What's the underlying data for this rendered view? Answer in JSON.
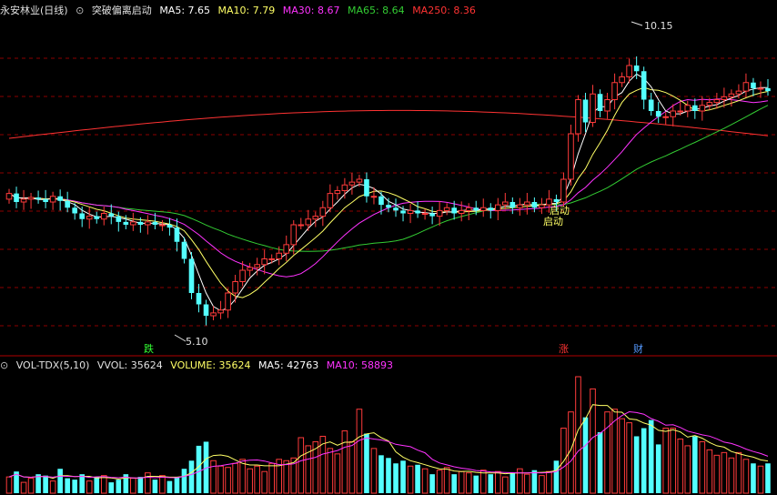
{
  "header": {
    "stock_title": "永安林业(日线)",
    "indicator_name": "突破偏离启动",
    "ma5": "MA5: 7.65",
    "ma10": "MA10: 7.79",
    "ma30": "MA30: 8.67",
    "ma65": "MA65: 8.64",
    "ma250": "MA250: 8.36"
  },
  "volume_header": {
    "indicator_name": "VOL-TDX(5,10)",
    "vvol": "VVOL: 35624",
    "volume": "VOLUME: 35624",
    "ma5": "MA5: 42763",
    "ma10": "MA10: 58893"
  },
  "colors": {
    "up": "#ff3b3b",
    "down": "#54ffff",
    "ma5": "#ffffff",
    "ma10": "#ffff66",
    "ma30": "#ff33ff",
    "ma65": "#33cc33",
    "ma250": "#ff3333",
    "grid": "#8b0000"
  },
  "annotations": {
    "high_label": "10.15",
    "low_label": "5.10",
    "signal_1": "启动",
    "signal_2": "启动",
    "marker_die": "跌",
    "marker_zhang": "涨",
    "marker_cai": "财"
  },
  "chart_data": [
    {
      "type": "candlestick",
      "title": "永安林业(日线)",
      "ylim": [
        4.9,
        10.5
      ],
      "high": 10.15,
      "low": 5.1,
      "series": {
        "open": [
          7.35,
          7.45,
          7.3,
          7.35,
          7.38,
          7.35,
          7.3,
          7.4,
          7.32,
          7.2,
          7.1,
          7.0,
          7.05,
          7.0,
          7.1,
          7.05,
          6.95,
          6.9,
          6.95,
          6.9,
          6.95,
          6.9,
          6.9,
          6.85,
          6.6,
          6.3,
          5.7,
          5.5,
          5.3,
          5.35,
          5.4,
          5.7,
          5.9,
          6.1,
          6.15,
          6.2,
          6.3,
          6.3,
          6.4,
          6.55,
          6.9,
          6.9,
          7.0,
          7.05,
          7.2,
          7.45,
          7.5,
          7.6,
          7.65,
          7.7,
          7.4,
          7.4,
          7.25,
          7.2,
          7.15,
          7.1,
          7.15,
          7.1,
          7.1,
          7.05,
          7.15,
          7.2,
          7.1,
          7.15,
          7.2,
          7.15,
          7.2,
          7.15,
          7.25,
          7.3,
          7.2,
          7.25,
          7.3,
          7.2,
          7.25,
          7.35,
          7.3,
          7.7,
          8.5,
          9.1,
          8.7,
          9.2,
          8.9,
          9.1,
          9.4,
          9.5,
          9.7,
          9.6,
          9.1,
          8.9,
          8.8,
          8.8,
          8.9,
          8.9,
          9.0,
          8.9,
          9.0,
          9.05,
          9.1,
          9.15,
          9.2,
          9.25,
          9.4,
          9.3,
          9.3
        ],
        "close": [
          7.45,
          7.3,
          7.35,
          7.38,
          7.35,
          7.3,
          7.4,
          7.32,
          7.2,
          7.1,
          7.0,
          7.05,
          7.0,
          7.1,
          7.05,
          6.95,
          6.9,
          6.95,
          6.9,
          6.95,
          6.9,
          6.9,
          6.85,
          6.6,
          6.3,
          5.7,
          5.5,
          5.3,
          5.35,
          5.4,
          5.7,
          5.9,
          6.1,
          6.15,
          6.2,
          6.3,
          6.3,
          6.4,
          6.55,
          6.9,
          6.9,
          7.0,
          7.05,
          7.2,
          7.45,
          7.5,
          7.6,
          7.65,
          7.7,
          7.4,
          7.4,
          7.25,
          7.2,
          7.15,
          7.1,
          7.15,
          7.1,
          7.1,
          7.05,
          7.15,
          7.2,
          7.1,
          7.15,
          7.2,
          7.15,
          7.2,
          7.15,
          7.25,
          7.3,
          7.2,
          7.25,
          7.3,
          7.2,
          7.25,
          7.35,
          7.3,
          7.7,
          8.5,
          9.1,
          8.7,
          9.2,
          8.9,
          9.1,
          9.4,
          9.5,
          9.7,
          9.6,
          9.1,
          8.9,
          8.8,
          8.8,
          8.9,
          8.9,
          9.0,
          8.9,
          9.0,
          9.05,
          9.1,
          9.15,
          9.2,
          9.25,
          9.4,
          9.3,
          9.3,
          9.25
        ],
        "volume": [
          12,
          16,
          8,
          11,
          14,
          13,
          9,
          18,
          11,
          10,
          14,
          9,
          12,
          13,
          8,
          10,
          14,
          11,
          12,
          15,
          10,
          13,
          9,
          12,
          18,
          24,
          35,
          38,
          24,
          20,
          19,
          22,
          25,
          18,
          20,
          16,
          22,
          25,
          24,
          26,
          41,
          35,
          38,
          42,
          33,
          29,
          46,
          38,
          62,
          44,
          33,
          28,
          26,
          22,
          24,
          20,
          21,
          18,
          14,
          17,
          19,
          14,
          16,
          15,
          13,
          17,
          14,
          16,
          12,
          15,
          18,
          14,
          17,
          13,
          16,
          24,
          48,
          60,
          86,
          56,
          77,
          45,
          60,
          62,
          55,
          52,
          42,
          48,
          54,
          36,
          48,
          48,
          40,
          35,
          42,
          38,
          32,
          28,
          30,
          26,
          30,
          25,
          22,
          20,
          22
        ]
      },
      "ma_labels": [
        "MA5",
        "MA10",
        "MA30",
        "MA65",
        "MA250"
      ]
    },
    {
      "type": "bar",
      "title": "VOL-TDX(5,10)",
      "series": [
        {
          "name": "VOLUME",
          "values": "see chart_data[0].series.volume"
        }
      ],
      "last_values": {
        "VVOL": 35624,
        "VOLUME": 35624,
        "MA5": 42763,
        "MA10": 58893
      }
    }
  ]
}
